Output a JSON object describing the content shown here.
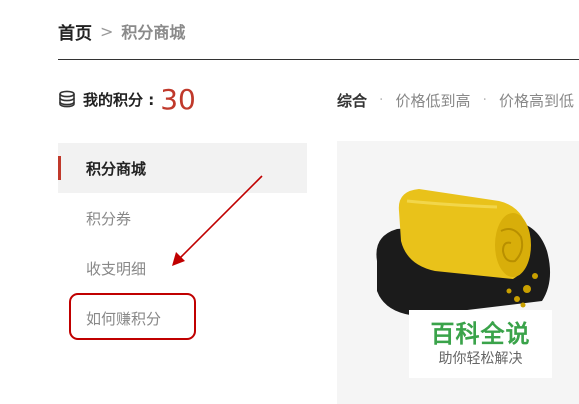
{
  "breadcrumb": {
    "home": "首页",
    "separator": ">",
    "current": "积分商城"
  },
  "points": {
    "icon": "coin-stack-icon",
    "label": "我的积分 :",
    "value": "30",
    "value_color": "#c0392b"
  },
  "sort": {
    "options": [
      {
        "label": "综合",
        "active": true
      },
      {
        "label": "价格低到高",
        "active": false
      },
      {
        "label": "价格高到低",
        "active": false
      }
    ],
    "separator": "·"
  },
  "sidebar": {
    "items": [
      {
        "label": "积分商城",
        "active": true
      },
      {
        "label": "积分券",
        "active": false
      },
      {
        "label": "收支明细",
        "active": false
      },
      {
        "label": "如何赚积分",
        "active": false,
        "highlighted": true
      }
    ],
    "accent_color": "#c0392b"
  },
  "annotation": {
    "arrow_color": "#c00000",
    "box_color": "#c00000"
  },
  "product": {
    "image": "rolled-towels-image"
  },
  "watermark": {
    "title": "百科全说",
    "subtitle": "助你轻松解决",
    "title_color": "#3aa34a"
  }
}
